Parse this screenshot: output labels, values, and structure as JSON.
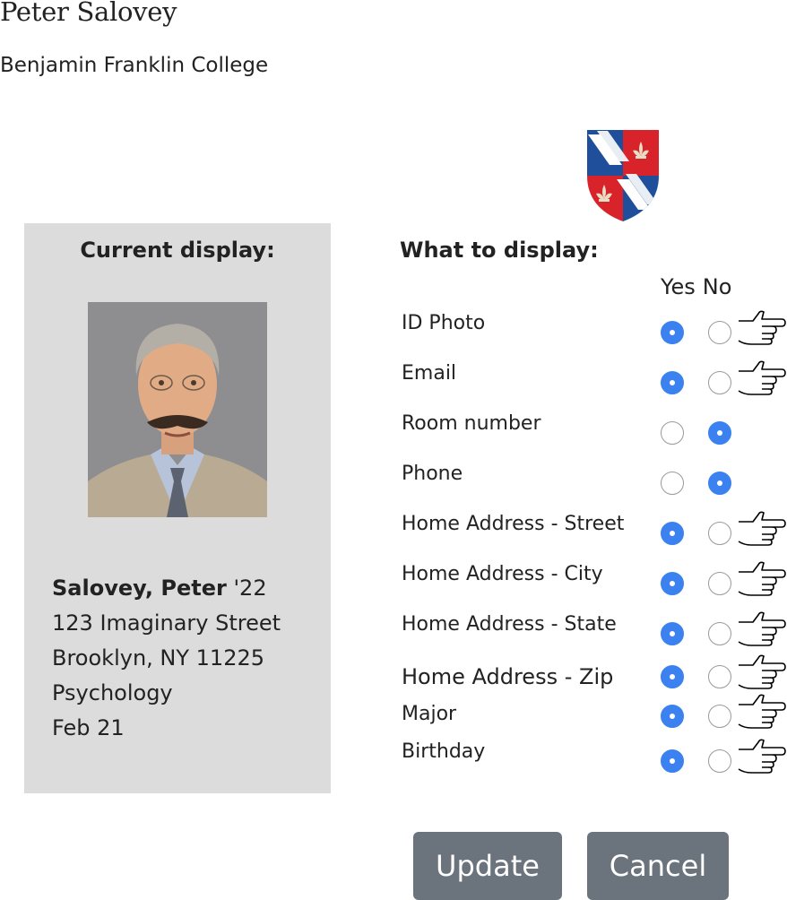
{
  "header": {
    "name": "Peter Salovey",
    "college": "Benjamin Franklin College"
  },
  "current": {
    "title": "Current display:",
    "name_bold": "Salovey, Peter",
    "class_year": " '22",
    "address": "123 Imaginary Street",
    "city_line": "Brooklyn, NY 11225",
    "major": "Psychology",
    "birthday": "Feb 21"
  },
  "settings": {
    "title": "What to display:",
    "yes_label": "Yes",
    "no_label": "No",
    "rows": [
      {
        "label": "ID Photo",
        "value": "yes"
      },
      {
        "label": "Email",
        "value": "yes"
      },
      {
        "label": "Room number",
        "value": "no"
      },
      {
        "label": "Phone",
        "value": "no"
      },
      {
        "label": "Home Address - Street",
        "value": "yes"
      },
      {
        "label": "Home Address - City",
        "value": "yes"
      },
      {
        "label": "Home Address - State",
        "value": "yes"
      },
      {
        "label": "Home Address - Zip",
        "value": "yes"
      },
      {
        "label": "Major",
        "value": "yes"
      },
      {
        "label": "Birthday",
        "value": "yes"
      }
    ]
  },
  "actions": {
    "update": "Update",
    "cancel": "Cancel"
  },
  "icons": {
    "crest": "college-crest-icon",
    "hand": "pointing-hand-icon"
  },
  "colors": {
    "radio_selected": "#3b82f0",
    "panel_bg": "#dcdcdc",
    "button_bg": "#6b747d"
  }
}
